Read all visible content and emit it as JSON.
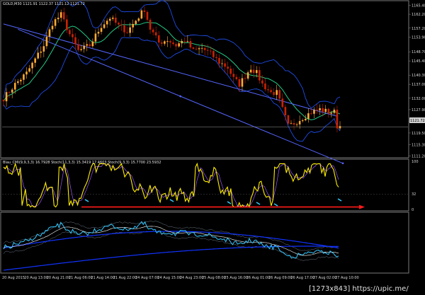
{
  "window": {
    "header": "GOLD,M30 1121.91 1122.37 1121.12 1121.72"
  },
  "osc_header": "Blau_CMI(9,9,3,3) 16.7928    Stoch(11,3,3) 15.3419 17.4603    Stoch(9,3,3) 15.7700 23.5932",
  "watermark": "[1273x843] https://upic.me/",
  "colors": {
    "background": "#000000",
    "bull": "#ffaa33",
    "bear": "#cc2200",
    "ma": "#22cc88",
    "band": "#2255ff",
    "trend": "#5566ff",
    "osc_main": "#ffee00",
    "osc_signal": "#9955ff",
    "red_arrow": "#ff1a1a",
    "cyan_arrow": "#33ccff",
    "bottom_fast": "#33bbee",
    "bottom_slow": "#1133ff"
  },
  "chart_data": [
    {
      "type": "candlestick",
      "symbol": "GOLD",
      "timeframe": "M30",
      "ylim": [
        1111.35,
        1166.55
      ],
      "price_labels": [
        "1165.40",
        "1162.20",
        "1157.20",
        "1153.90",
        "1148.70",
        "1145.40",
        "1140.30",
        "1137.00",
        "1132.00",
        "1127.90",
        "1123.70",
        "1121.72",
        "1119.50",
        "1115.30",
        "1111.20"
      ],
      "current_price": "1121.72",
      "time_labels": [
        "20 Aug 2015",
        "20 Aug 13:00",
        "20 Aug 21:00",
        "21 Aug 06:00",
        "21 Aug 14:00",
        "21 Aug 22:00",
        "24 Aug 07:00",
        "24 Aug 15:00",
        "24 Aug 23:00",
        "25 Aug 08:00",
        "25 Aug 16:00",
        "26 Aug 01:00",
        "26 Aug 09:00",
        "26 Aug 17:00",
        "27 Aug 02:00",
        "27 Aug 10:00"
      ],
      "close_anchors": [
        [
          0,
          1132
        ],
        [
          4,
          1137
        ],
        [
          8,
          1141
        ],
        [
          11,
          1146
        ],
        [
          14,
          1151
        ],
        [
          17,
          1159
        ],
        [
          20,
          1162
        ],
        [
          23,
          1155
        ],
        [
          26,
          1149
        ],
        [
          30,
          1151
        ],
        [
          34,
          1158
        ],
        [
          37,
          1161
        ],
        [
          40,
          1158
        ],
        [
          43,
          1156
        ],
        [
          46,
          1160
        ],
        [
          49,
          1164
        ],
        [
          51,
          1157
        ],
        [
          54,
          1152
        ],
        [
          57,
          1153
        ],
        [
          60,
          1151
        ],
        [
          63,
          1153
        ],
        [
          66,
          1149
        ],
        [
          69,
          1150
        ],
        [
          72,
          1148
        ],
        [
          75,
          1145
        ],
        [
          78,
          1143
        ],
        [
          80,
          1139
        ],
        [
          82,
          1137
        ],
        [
          84,
          1140
        ],
        [
          86,
          1143
        ],
        [
          88,
          1141
        ],
        [
          90,
          1137
        ],
        [
          93,
          1134
        ],
        [
          95,
          1134
        ],
        [
          97,
          1128
        ],
        [
          99,
          1122
        ],
        [
          101,
          1123
        ],
        [
          104,
          1125
        ],
        [
          107,
          1127
        ],
        [
          110,
          1128
        ],
        [
          113,
          1127
        ],
        [
          115,
          1127
        ],
        [
          116,
          1122
        ]
      ],
      "trend_lines": [
        {
          "from": [
            0,
            1158.7
          ],
          "to": [
            116,
            1125.5
          ]
        },
        {
          "from": [
            5,
            1156.8
          ],
          "to": [
            118,
            1108.6
          ]
        }
      ]
    },
    {
      "type": "line",
      "name": "oscillator",
      "ylim": [
        0,
        100
      ],
      "levels": [
        "100",
        "32",
        "0"
      ],
      "signal_arrow_level": 5
    },
    {
      "type": "line",
      "name": "bottom_indicator"
    }
  ]
}
